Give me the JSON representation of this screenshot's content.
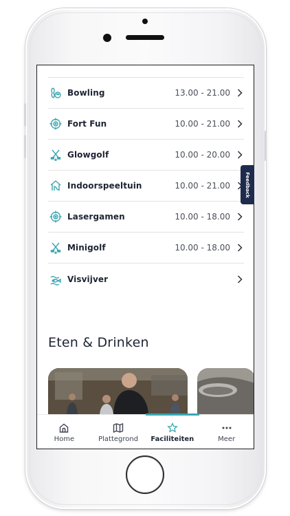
{
  "colors": {
    "accent": "#3aa6b0",
    "text": "#1d2433",
    "feedback_bg": "#1f2b4d"
  },
  "facilities": [
    {
      "label": "Bowling",
      "hours": "13.00 - 21.00",
      "icon": "bowling-icon"
    },
    {
      "label": "Fort Fun",
      "hours": "10.00 - 21.00",
      "icon": "target-icon"
    },
    {
      "label": "Glowgolf",
      "hours": "10.00 - 20.00",
      "icon": "golf-clubs-icon"
    },
    {
      "label": "Indoorspeeltuin",
      "hours": "10.00 - 21.00",
      "icon": "house-slide-icon"
    },
    {
      "label": "Lasergamen",
      "hours": "10.00 - 18.00",
      "icon": "target-icon"
    },
    {
      "label": "Minigolf",
      "hours": "10.00 - 18.00",
      "icon": "golf-clubs-icon"
    },
    {
      "label": "Visvijver",
      "hours": "",
      "icon": "fish-icon"
    }
  ],
  "section": {
    "title": "Eten & Drinken"
  },
  "feedback": {
    "label": "Feedback"
  },
  "nav": {
    "items": [
      {
        "label": "Home",
        "icon": "home-icon",
        "active": false
      },
      {
        "label": "Plattegrond",
        "icon": "map-icon",
        "active": false
      },
      {
        "label": "Faciliteiten",
        "icon": "star-icon",
        "active": true
      },
      {
        "label": "Meer",
        "icon": "more-icon",
        "active": false
      }
    ]
  }
}
